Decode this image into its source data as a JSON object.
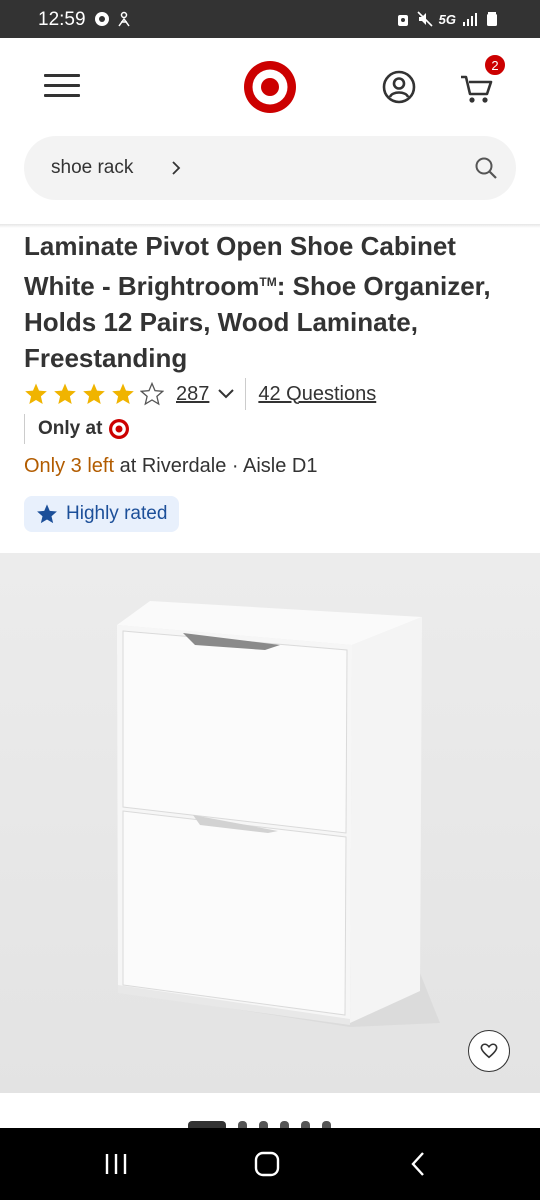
{
  "status_bar": {
    "time": "12:59",
    "network": "5G",
    "left_icons": [
      "camera-notification-icon",
      "accessibility-icon"
    ],
    "right_icons": [
      "alarm-icon",
      "mute-icon",
      "signal-icon",
      "battery-icon"
    ]
  },
  "header": {
    "menu_icon": "hamburger-menu-icon",
    "logo": "target-logo",
    "account_icon": "account-icon",
    "cart_icon": "cart-icon",
    "cart_count": "2",
    "brand_color": "#cc0000"
  },
  "search": {
    "query": "shoe rack",
    "icon": "search-icon"
  },
  "product": {
    "title": "Laminate Pivot Open Shoe Cabinet White - Brightroom",
    "title_mark": "TM",
    "title_rest": ": Shoe Organizer, Holds 12 Pairs, Wood Laminate, Freestanding",
    "rating": 4,
    "rating_max": 5,
    "review_count": "287",
    "questions": "42 Questions",
    "only_at": "Only at",
    "stock_left": "Only 3 left",
    "stock_location": " at Riverdale · Aisle D1",
    "badge": "Highly rated",
    "star_color": "#f0b400"
  },
  "gallery": {
    "image_count": 6,
    "active_index": 0,
    "favorite_icon": "heart-icon"
  },
  "nav_bar": {
    "buttons": [
      "recent-apps-icon",
      "home-icon",
      "back-icon"
    ]
  }
}
